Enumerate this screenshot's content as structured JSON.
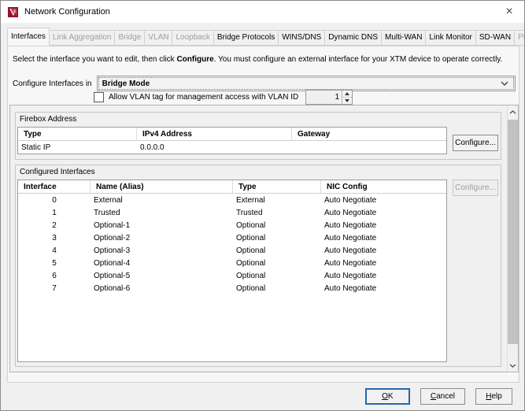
{
  "window": {
    "title": "Network Configuration",
    "close_glyph": "×"
  },
  "tabs": [
    {
      "label": "Interfaces",
      "state": "active"
    },
    {
      "label": "Link Aggregation",
      "state": "disabled"
    },
    {
      "label": "Bridge",
      "state": "disabled"
    },
    {
      "label": "VLAN",
      "state": "disabled"
    },
    {
      "label": "Loopback",
      "state": "disabled"
    },
    {
      "label": "Bridge Protocols",
      "state": "enabled"
    },
    {
      "label": "WINS/DNS",
      "state": "enabled"
    },
    {
      "label": "Dynamic DNS",
      "state": "enabled"
    },
    {
      "label": "Multi-WAN",
      "state": "enabled"
    },
    {
      "label": "Link Monitor",
      "state": "enabled"
    },
    {
      "label": "SD-WAN",
      "state": "enabled"
    },
    {
      "label": "PPPoE",
      "state": "disabled"
    }
  ],
  "instruction": {
    "pre": "Select the interface you want to edit, then click ",
    "bold": "Configure",
    "post": ". You must configure an external interface for your XTM device to operate correctly."
  },
  "mode": {
    "label": "Configure Interfaces in",
    "value": "Bridge Mode"
  },
  "vlan": {
    "label": "Allow VLAN tag for management access with VLAN ID",
    "value": "1",
    "checked": false
  },
  "firebox_address": {
    "title": "Firebox Address",
    "columns": [
      "Type",
      "IPv4 Address",
      "Gateway"
    ],
    "rows": [
      [
        "Static IP",
        "0.0.0.0",
        ""
      ]
    ],
    "configure_label": "Configure..."
  },
  "configured_interfaces": {
    "title": "Configured Interfaces",
    "columns": [
      "Interface",
      "Name (Alias)",
      "Type",
      "NIC Config"
    ],
    "rows": [
      [
        "0",
        "External",
        "External",
        "Auto Negotiate"
      ],
      [
        "1",
        "Trusted",
        "Trusted",
        "Auto Negotiate"
      ],
      [
        "2",
        "Optional-1",
        "Optional",
        "Auto Negotiate"
      ],
      [
        "3",
        "Optional-2",
        "Optional",
        "Auto Negotiate"
      ],
      [
        "4",
        "Optional-3",
        "Optional",
        "Auto Negotiate"
      ],
      [
        "5",
        "Optional-4",
        "Optional",
        "Auto Negotiate"
      ],
      [
        "6",
        "Optional-5",
        "Optional",
        "Auto Negotiate"
      ],
      [
        "7",
        "Optional-6",
        "Optional",
        "Auto Negotiate"
      ]
    ],
    "configure_label": "Configure..."
  },
  "footer": {
    "ok_mn": "O",
    "ok_rest": "K",
    "cancel_mn": "C",
    "cancel_rest": "ancel",
    "help_mn": "H",
    "help_rest": "elp"
  },
  "colors": {
    "default_button_accent": "#2965ad",
    "brand_red": "#a31f34",
    "disabled_text": "#9f9f9f",
    "panel_bg": "#f7f7f7"
  }
}
